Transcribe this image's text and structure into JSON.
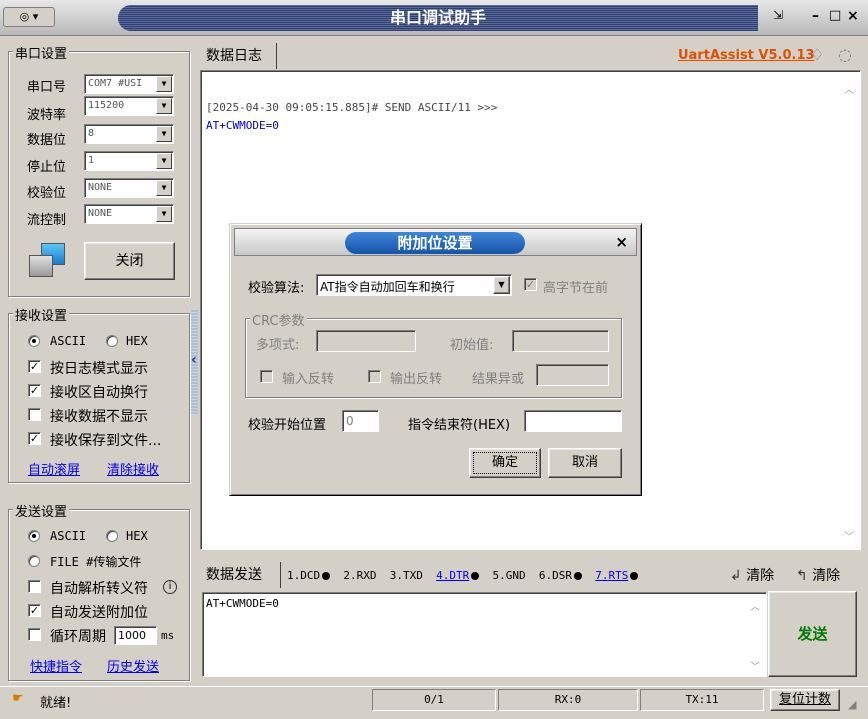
{
  "window": {
    "title": "串口调试助手",
    "app_version": "UartAssist V5.0.13"
  },
  "serial": {
    "group_title": "串口设置",
    "rows": [
      {
        "label": "串口号",
        "value": "COM7 #USI"
      },
      {
        "label": "波特率",
        "value": "115200"
      },
      {
        "label": "数据位",
        "value": "8"
      },
      {
        "label": "停止位",
        "value": "1"
      },
      {
        "label": "校验位",
        "value": "NONE"
      },
      {
        "label": "流控制",
        "value": "NONE"
      }
    ],
    "close_label": "关闭"
  },
  "receive": {
    "group_title": "接收设置",
    "ascii": "ASCII",
    "hex": "HEX",
    "options": [
      {
        "label": "按日志模式显示",
        "checked": "✓"
      },
      {
        "label": "接收区自动换行",
        "checked": "✓"
      },
      {
        "label": "接收数据不显示",
        "checked": ""
      },
      {
        "label": "接收保存到文件...",
        "checked": "✓"
      }
    ],
    "auto_scroll": "自动滚屏",
    "clear_recv": "清除接收"
  },
  "send": {
    "group_title": "发送设置",
    "ascii": "ASCII",
    "hex": "HEX",
    "file": "FILE #传输文件",
    "parse_escape": "自动解析转义符",
    "auto_append": "自动发送附加位",
    "cycle": "循环周期",
    "cycle_value": "1000",
    "cycle_unit": "ms",
    "shortcuts": "快捷指令",
    "history": "历史发送"
  },
  "log": {
    "tab": "数据日志",
    "line1": "[2025-04-30 09:05:15.885]# SEND ASCII/11 >>>",
    "line2": "AT+CWMODE=0"
  },
  "sendbar": {
    "tab": "数据发送",
    "pins": [
      "1.DCD",
      "2.RXD",
      "3.TXD",
      "4.DTR",
      "5.GND",
      "6.DSR",
      "7.RTS"
    ],
    "clear1": "清除",
    "clear2": "清除",
    "text": "AT+CWMODE=0",
    "send_button": "发送"
  },
  "status": {
    "ready": "就绪!",
    "count": "0/1",
    "rx": "RX:0",
    "tx": "TX:11",
    "reset": "复位计数"
  },
  "dialog": {
    "title": "附加位设置",
    "algo_label": "校验算法:",
    "algo_value": "AT指令自动加回车和换行",
    "high_byte_first": "高字节在前",
    "crc_group": "CRC参数",
    "poly": "多项式:",
    "init": "初始值:",
    "in_reverse": "输入反转",
    "out_reverse": "输出反转",
    "xor": "结果异或",
    "start_pos_label": "校验开始位置",
    "start_pos_value": "0",
    "end_label": "指令结束符(HEX)",
    "end_value": "",
    "ok": "确定",
    "cancel": "取消"
  }
}
